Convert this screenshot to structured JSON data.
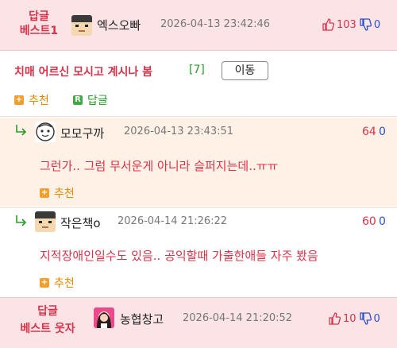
{
  "best_top": {
    "label_line1": "답글",
    "label_line2": "베스트1",
    "nickname": "엑스오빠",
    "date": "2026-04-13 23:42:46",
    "up_count": "103",
    "down_count": "0"
  },
  "post": {
    "title": "치매 어르신 모시고 계시나 봄",
    "reply_count": "[7]",
    "move_button": "이동",
    "recommend_label": "추천",
    "reply_label": "답글"
  },
  "replies": [
    {
      "nickname": "모모구까",
      "date": "2026-04-13 23:43:51",
      "up_count": "64",
      "down_count": "0",
      "content": "그런가.. 그럼 무서운게 아니라 슬퍼지는데..ㅠㅠ",
      "recommend_label": "추천"
    },
    {
      "nickname": "작은책o",
      "date": "2026-04-14 21:26:22",
      "up_count": "60",
      "down_count": "0",
      "content": "지적장애인일수도 있음.. 공익할때 가출한애들 자주 봤음",
      "recommend_label": "추천"
    }
  ],
  "best_bottom": {
    "label_line1": "답글",
    "label_line2": "베스트 웃자",
    "nickname": "농협창고",
    "date": "2026-04-14 21:20:52",
    "up_count": "10",
    "down_count": "0"
  },
  "icons": {
    "thumb_up": "thumb-up-icon",
    "thumb_down": "thumb-down-icon",
    "reply_arrow": "reply-arrow-icon",
    "plus": "plus-icon",
    "reply_r": "reply-r-icon"
  },
  "colors": {
    "best_bg": "#fbe3e6",
    "reply_highlight_bg": "#fff1e6",
    "accent_red": "#d8334a",
    "accent_blue": "#2a50c8",
    "accent_green": "#2a9b2a",
    "recommend_orange": "#e08a00"
  }
}
